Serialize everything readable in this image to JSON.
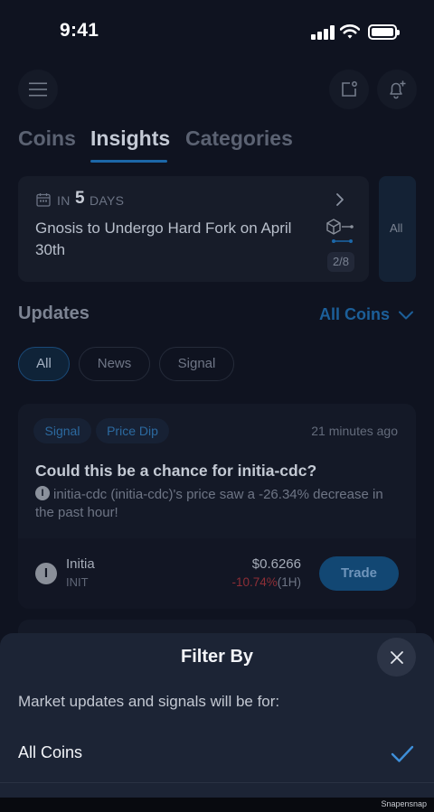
{
  "status_bar": {
    "time": "9:41"
  },
  "header": {
    "menu_icon": "hamburger-menu-icon",
    "note_icon": "note-icon",
    "bell_icon": "bell-plus-icon"
  },
  "tabs": [
    {
      "label": "Coins",
      "active": false
    },
    {
      "label": "Insights",
      "active": true
    },
    {
      "label": "Categories",
      "active": false
    }
  ],
  "event_card": {
    "prefix": "IN",
    "count": "5",
    "unit": "DAYS",
    "title": "Gnosis to Undergo Hard Fork on April 30th",
    "counter": "2/8",
    "all_label": "All"
  },
  "updates": {
    "title": "Updates",
    "coin_filter": "All Coins",
    "chips": [
      {
        "label": "All",
        "selected": true
      },
      {
        "label": "News",
        "selected": false
      },
      {
        "label": "Signal",
        "selected": false
      }
    ],
    "card": {
      "tags": [
        "Signal",
        "Price Dip"
      ],
      "time_ago": "21 minutes ago",
      "heading": "Could this be a chance for initia-cdc?",
      "description": "initia-cdc (initia-cdc)'s price saw a -26.34% decrease in the past hour!",
      "coin_name": "Initia",
      "coin_symbol": "INIT",
      "price": "$0.6266",
      "change_value": "-10.74%",
      "change_period": "(1H)",
      "trade_label": "Trade"
    }
  },
  "filter_sheet": {
    "title": "Filter By",
    "subtitle": "Market updates and signals will be for:",
    "option": "All Coins",
    "option_selected": true
  },
  "watermark": "Snapensnap",
  "colors": {
    "accent": "#1c67a8",
    "negative": "#8d2e36",
    "sheet_background": "#1c2435"
  }
}
